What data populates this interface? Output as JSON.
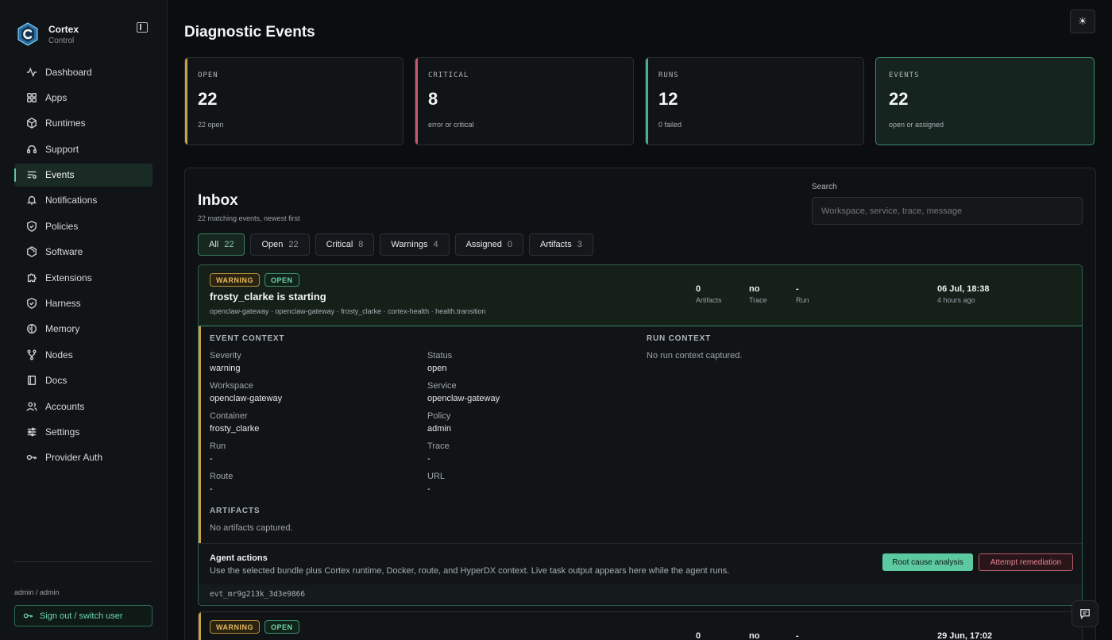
{
  "brand": {
    "name": "Cortex",
    "subtitle": "Control"
  },
  "sidebar": {
    "items": [
      {
        "label": "Dashboard",
        "icon": "activity-icon"
      },
      {
        "label": "Apps",
        "icon": "grid-icon"
      },
      {
        "label": "Runtimes",
        "icon": "box-icon"
      },
      {
        "label": "Support",
        "icon": "headset-icon"
      },
      {
        "label": "Events",
        "icon": "list-filter-icon",
        "active": true
      },
      {
        "label": "Notifications",
        "icon": "bell-icon"
      },
      {
        "label": "Policies",
        "icon": "shield-check-icon"
      },
      {
        "label": "Software",
        "icon": "package-icon"
      },
      {
        "label": "Extensions",
        "icon": "puzzle-icon"
      },
      {
        "label": "Harness",
        "icon": "shield-icon"
      },
      {
        "label": "Memory",
        "icon": "brain-icon"
      },
      {
        "label": "Nodes",
        "icon": "git-fork-icon"
      },
      {
        "label": "Docs",
        "icon": "book-icon"
      },
      {
        "label": "Accounts",
        "icon": "users-icon"
      },
      {
        "label": "Settings",
        "icon": "sliders-icon"
      },
      {
        "label": "Provider Auth",
        "icon": "key-icon"
      }
    ],
    "user": "admin / admin",
    "signout_label": "Sign out / switch user"
  },
  "page": {
    "title": "Diagnostic Events",
    "theme_icon": "☀"
  },
  "stats": [
    {
      "label": "OPEN",
      "value": "22",
      "sub": "22 open",
      "accent": "#c8a24a"
    },
    {
      "label": "CRITICAL",
      "value": "8",
      "sub": "error or critical",
      "accent": "#c55a6e"
    },
    {
      "label": "RUNS",
      "value": "12",
      "sub": "0 failed",
      "accent": "#4fae8a"
    },
    {
      "label": "EVENTS",
      "value": "22",
      "sub": "open or assigned",
      "accent": "#3d8d70"
    }
  ],
  "inbox": {
    "title": "Inbox",
    "subtitle": "22 matching events, newest first",
    "search_label": "Search",
    "search_placeholder": "Workspace, service, trace, message",
    "filters": [
      {
        "label": "All",
        "count": "22",
        "active": true
      },
      {
        "label": "Open",
        "count": "22"
      },
      {
        "label": "Critical",
        "count": "8"
      },
      {
        "label": "Warnings",
        "count": "4"
      },
      {
        "label": "Assigned",
        "count": "0"
      },
      {
        "label": "Artifacts",
        "count": "3"
      }
    ]
  },
  "event": {
    "badge_severity": "WARNING",
    "badge_status": "OPEN",
    "title": "frosty_clarke is starting",
    "path": "openclaw-gateway · openclaw-gateway · frosty_clarke · cortex-health · health.transition",
    "metrics": [
      {
        "value": "0",
        "label": "Artifacts"
      },
      {
        "value": "no",
        "label": "Trace"
      },
      {
        "value": "-",
        "label": "Run"
      }
    ],
    "date": "06 Jul, 18:38",
    "ago": "4 hours ago",
    "event_context_label": "EVENT CONTEXT",
    "run_context_label": "RUN CONTEXT",
    "run_context_empty": "No run context captured.",
    "fields": [
      {
        "key": "Severity",
        "value": "warning"
      },
      {
        "key": "Status",
        "value": "open"
      },
      {
        "key": "Workspace",
        "value": "openclaw-gateway"
      },
      {
        "key": "Service",
        "value": "openclaw-gateway"
      },
      {
        "key": "Container",
        "value": "frosty_clarke"
      },
      {
        "key": "Policy",
        "value": "admin"
      },
      {
        "key": "Run",
        "value": "-"
      },
      {
        "key": "Trace",
        "value": "-"
      },
      {
        "key": "Route",
        "value": "-"
      },
      {
        "key": "URL",
        "value": "-"
      }
    ],
    "artifacts_label": "ARTIFACTS",
    "artifacts_empty": "No artifacts captured.",
    "agent_actions_title": "Agent actions",
    "agent_actions_desc": "Use the selected bundle plus Cortex runtime, Docker, route, and HyperDX context. Live task output appears here while the agent runs.",
    "rca_label": "Root cause analysis",
    "remediation_label": "Attempt remediation",
    "event_id": "evt_mr9g213k_3d3e9866"
  },
  "event2": {
    "badge_severity": "WARNING",
    "badge_status": "OPEN",
    "metrics": [
      {
        "value": "0"
      },
      {
        "value": "no"
      },
      {
        "value": "-"
      }
    ],
    "date": "29 Jun, 17:02"
  },
  "colors": {
    "accent": "#5cc9a0",
    "warning": "#c9a24c",
    "critical": "#c55a6e"
  }
}
